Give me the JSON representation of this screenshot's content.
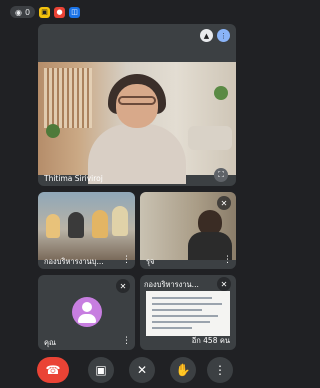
{
  "status_bar": {
    "viewer_count": "0"
  },
  "main_tile": {
    "participant_name": "Thitima Siriviroj"
  },
  "tiles": [
    {
      "name": "กองบริหารงานบุ..."
    },
    {
      "name": "รุจ"
    },
    {
      "name": "คุณ"
    },
    {
      "name": "กองบริหารงาน...",
      "more_label": "อีก 458 คน"
    }
  ],
  "colors": {
    "accent": "#8ab4f8",
    "end_call": "#ea4335",
    "avatar": "#c77ee0",
    "background": "#202124"
  },
  "icons": {
    "status": [
      "eye-icon",
      "chat-icon",
      "record-icon",
      "screen-icon"
    ],
    "controls": [
      "end-call-icon",
      "camera-off-icon",
      "mic-off-icon",
      "raise-hand-icon",
      "more-vert-icon"
    ]
  }
}
